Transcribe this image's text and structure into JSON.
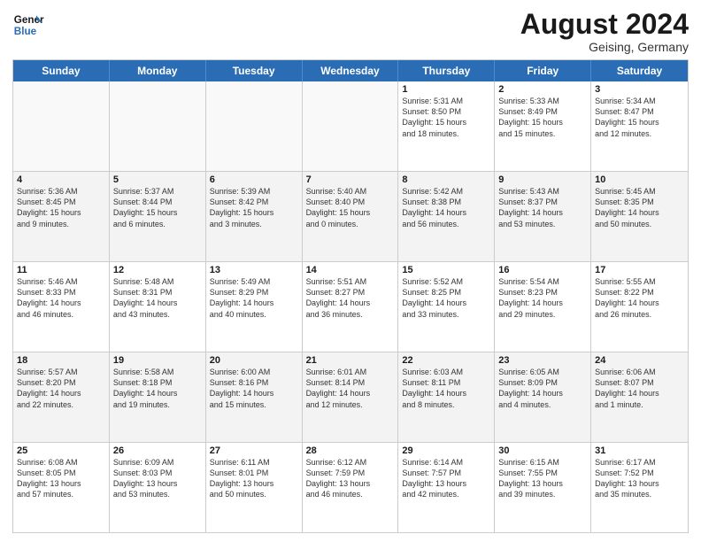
{
  "header": {
    "logo_line1": "General",
    "logo_line2": "Blue",
    "month_year": "August 2024",
    "location": "Geising, Germany"
  },
  "weekdays": [
    "Sunday",
    "Monday",
    "Tuesday",
    "Wednesday",
    "Thursday",
    "Friday",
    "Saturday"
  ],
  "rows": [
    [
      {
        "day": "",
        "text": ""
      },
      {
        "day": "",
        "text": ""
      },
      {
        "day": "",
        "text": ""
      },
      {
        "day": "",
        "text": ""
      },
      {
        "day": "1",
        "text": "Sunrise: 5:31 AM\nSunset: 8:50 PM\nDaylight: 15 hours\nand 18 minutes."
      },
      {
        "day": "2",
        "text": "Sunrise: 5:33 AM\nSunset: 8:49 PM\nDaylight: 15 hours\nand 15 minutes."
      },
      {
        "day": "3",
        "text": "Sunrise: 5:34 AM\nSunset: 8:47 PM\nDaylight: 15 hours\nand 12 minutes."
      }
    ],
    [
      {
        "day": "4",
        "text": "Sunrise: 5:36 AM\nSunset: 8:45 PM\nDaylight: 15 hours\nand 9 minutes."
      },
      {
        "day": "5",
        "text": "Sunrise: 5:37 AM\nSunset: 8:44 PM\nDaylight: 15 hours\nand 6 minutes."
      },
      {
        "day": "6",
        "text": "Sunrise: 5:39 AM\nSunset: 8:42 PM\nDaylight: 15 hours\nand 3 minutes."
      },
      {
        "day": "7",
        "text": "Sunrise: 5:40 AM\nSunset: 8:40 PM\nDaylight: 15 hours\nand 0 minutes."
      },
      {
        "day": "8",
        "text": "Sunrise: 5:42 AM\nSunset: 8:38 PM\nDaylight: 14 hours\nand 56 minutes."
      },
      {
        "day": "9",
        "text": "Sunrise: 5:43 AM\nSunset: 8:37 PM\nDaylight: 14 hours\nand 53 minutes."
      },
      {
        "day": "10",
        "text": "Sunrise: 5:45 AM\nSunset: 8:35 PM\nDaylight: 14 hours\nand 50 minutes."
      }
    ],
    [
      {
        "day": "11",
        "text": "Sunrise: 5:46 AM\nSunset: 8:33 PM\nDaylight: 14 hours\nand 46 minutes."
      },
      {
        "day": "12",
        "text": "Sunrise: 5:48 AM\nSunset: 8:31 PM\nDaylight: 14 hours\nand 43 minutes."
      },
      {
        "day": "13",
        "text": "Sunrise: 5:49 AM\nSunset: 8:29 PM\nDaylight: 14 hours\nand 40 minutes."
      },
      {
        "day": "14",
        "text": "Sunrise: 5:51 AM\nSunset: 8:27 PM\nDaylight: 14 hours\nand 36 minutes."
      },
      {
        "day": "15",
        "text": "Sunrise: 5:52 AM\nSunset: 8:25 PM\nDaylight: 14 hours\nand 33 minutes."
      },
      {
        "day": "16",
        "text": "Sunrise: 5:54 AM\nSunset: 8:23 PM\nDaylight: 14 hours\nand 29 minutes."
      },
      {
        "day": "17",
        "text": "Sunrise: 5:55 AM\nSunset: 8:22 PM\nDaylight: 14 hours\nand 26 minutes."
      }
    ],
    [
      {
        "day": "18",
        "text": "Sunrise: 5:57 AM\nSunset: 8:20 PM\nDaylight: 14 hours\nand 22 minutes."
      },
      {
        "day": "19",
        "text": "Sunrise: 5:58 AM\nSunset: 8:18 PM\nDaylight: 14 hours\nand 19 minutes."
      },
      {
        "day": "20",
        "text": "Sunrise: 6:00 AM\nSunset: 8:16 PM\nDaylight: 14 hours\nand 15 minutes."
      },
      {
        "day": "21",
        "text": "Sunrise: 6:01 AM\nSunset: 8:14 PM\nDaylight: 14 hours\nand 12 minutes."
      },
      {
        "day": "22",
        "text": "Sunrise: 6:03 AM\nSunset: 8:11 PM\nDaylight: 14 hours\nand 8 minutes."
      },
      {
        "day": "23",
        "text": "Sunrise: 6:05 AM\nSunset: 8:09 PM\nDaylight: 14 hours\nand 4 minutes."
      },
      {
        "day": "24",
        "text": "Sunrise: 6:06 AM\nSunset: 8:07 PM\nDaylight: 14 hours\nand 1 minute."
      }
    ],
    [
      {
        "day": "25",
        "text": "Sunrise: 6:08 AM\nSunset: 8:05 PM\nDaylight: 13 hours\nand 57 minutes."
      },
      {
        "day": "26",
        "text": "Sunrise: 6:09 AM\nSunset: 8:03 PM\nDaylight: 13 hours\nand 53 minutes."
      },
      {
        "day": "27",
        "text": "Sunrise: 6:11 AM\nSunset: 8:01 PM\nDaylight: 13 hours\nand 50 minutes."
      },
      {
        "day": "28",
        "text": "Sunrise: 6:12 AM\nSunset: 7:59 PM\nDaylight: 13 hours\nand 46 minutes."
      },
      {
        "day": "29",
        "text": "Sunrise: 6:14 AM\nSunset: 7:57 PM\nDaylight: 13 hours\nand 42 minutes."
      },
      {
        "day": "30",
        "text": "Sunrise: 6:15 AM\nSunset: 7:55 PM\nDaylight: 13 hours\nand 39 minutes."
      },
      {
        "day": "31",
        "text": "Sunrise: 6:17 AM\nSunset: 7:52 PM\nDaylight: 13 hours\nand 35 minutes."
      }
    ]
  ]
}
